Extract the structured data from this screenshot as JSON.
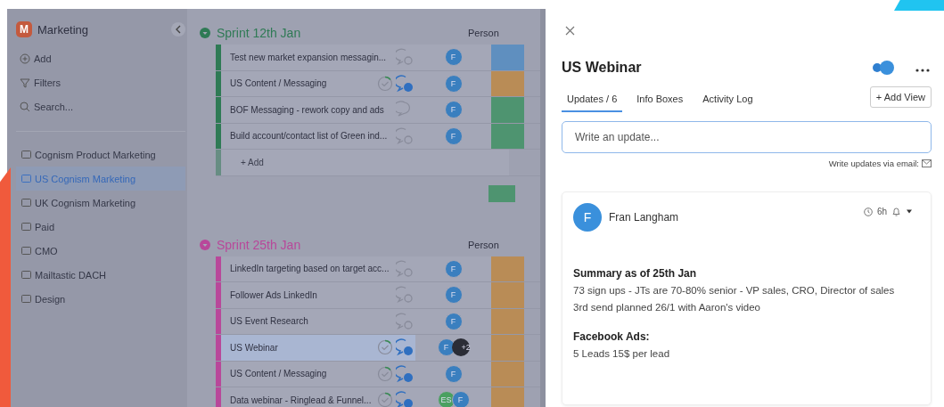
{
  "sidebar": {
    "logo": "M",
    "title": "Marketing",
    "actions": [
      {
        "kind": "add",
        "label": "Add"
      },
      {
        "kind": "filter",
        "label": "Filters"
      },
      {
        "kind": "search",
        "label": "Search..."
      }
    ],
    "boards": [
      {
        "label": "Cognism Product Marketing",
        "selected": false
      },
      {
        "label": "US Cognism Marketing",
        "selected": true
      },
      {
        "label": "UK Cognism Marketing",
        "selected": false
      },
      {
        "label": "Paid",
        "selected": false
      },
      {
        "label": "CMO",
        "selected": false
      },
      {
        "label": "Mailtastic DACH",
        "selected": false
      },
      {
        "label": "Design",
        "selected": false
      }
    ]
  },
  "groups": [
    {
      "name": "Sprint 12th Jan",
      "color": "#2f7a55",
      "column": "Person",
      "add_label": "+ Add",
      "rows": [
        {
          "name": "Test new market expansion messagin...",
          "progress": false,
          "comments": {
            "kind": "empty"
          },
          "people": [
            "F"
          ],
          "status": {
            "color": "#5f8fbf"
          },
          "selected": false
        },
        {
          "name": "US Content / Messaging",
          "progress": true,
          "comments": {
            "kind": "active"
          },
          "people": [
            "F"
          ],
          "status": {
            "color": "#b98c56"
          },
          "selected": false
        },
        {
          "name": "BOF Messaging - rework copy and ads",
          "progress": false,
          "comments": {
            "kind": "none"
          },
          "people": [
            "F"
          ],
          "status": {
            "color": "#4e9470"
          },
          "selected": false
        },
        {
          "name": "Build account/contact list of Green ind...",
          "progress": false,
          "comments": {
            "kind": "empty"
          },
          "people": [
            "F"
          ],
          "status": {
            "color": "#4e9470"
          },
          "selected": false
        }
      ]
    },
    {
      "name": "Sprint 25th Jan",
      "color": "#b8489a",
      "column": "Person",
      "rows": [
        {
          "name": "LinkedIn targeting based on target acc...",
          "progress": false,
          "comments": {
            "kind": "empty"
          },
          "people": [
            "F"
          ],
          "status": {
            "color": "#b98c56"
          },
          "selected": false
        },
        {
          "name": "Follower Ads LinkedIn",
          "progress": false,
          "comments": {
            "kind": "empty"
          },
          "people": [
            "F"
          ],
          "status": {
            "color": "#b98c56"
          },
          "selected": false
        },
        {
          "name": "US Event Research",
          "progress": false,
          "comments": {
            "kind": "empty"
          },
          "people": [
            "F"
          ],
          "status": {
            "color": "#b98c56"
          },
          "selected": false
        },
        {
          "name": "US Webinar",
          "progress": true,
          "comments": {
            "kind": "active"
          },
          "people": [
            "F",
            "+2"
          ],
          "status": {
            "color": "#b98c56"
          },
          "selected": true
        },
        {
          "name": "US Content / Messaging",
          "progress": true,
          "comments": {
            "kind": "active"
          },
          "people": [
            "F"
          ],
          "status": {
            "color": "#b98c56"
          },
          "selected": false
        },
        {
          "name": "Data webinar - Ringlead & Funnel...",
          "progress": true,
          "comments": {
            "kind": "active"
          },
          "people": [
            "ES",
            "F"
          ],
          "status": {
            "color": "#b98c56"
          },
          "selected": false
        }
      ]
    }
  ],
  "panel": {
    "title": "US Webinar",
    "tabs": [
      {
        "label": "Updates / 6",
        "selected": true
      },
      {
        "label": "Info Boxes",
        "selected": false
      },
      {
        "label": "Activity Log",
        "selected": false
      }
    ],
    "add_view": "+ Add View",
    "placeholder": "Write an update...",
    "email_link": "Write updates via email:",
    "post": {
      "avatar": "F",
      "author": "Fran Langham",
      "time": "6h",
      "paragraphs": [
        {
          "heading": "Summary as of 25th Jan",
          "lines": [
            "73 sign ups - JTs are 70-80% senior - VP sales, CRO, Director of sales",
            "3rd send planned 26/1 with Aaron's video"
          ]
        },
        {
          "heading": "Facebook Ads:",
          "lines": [
            "5 Leads 15$ per lead"
          ]
        }
      ]
    }
  }
}
